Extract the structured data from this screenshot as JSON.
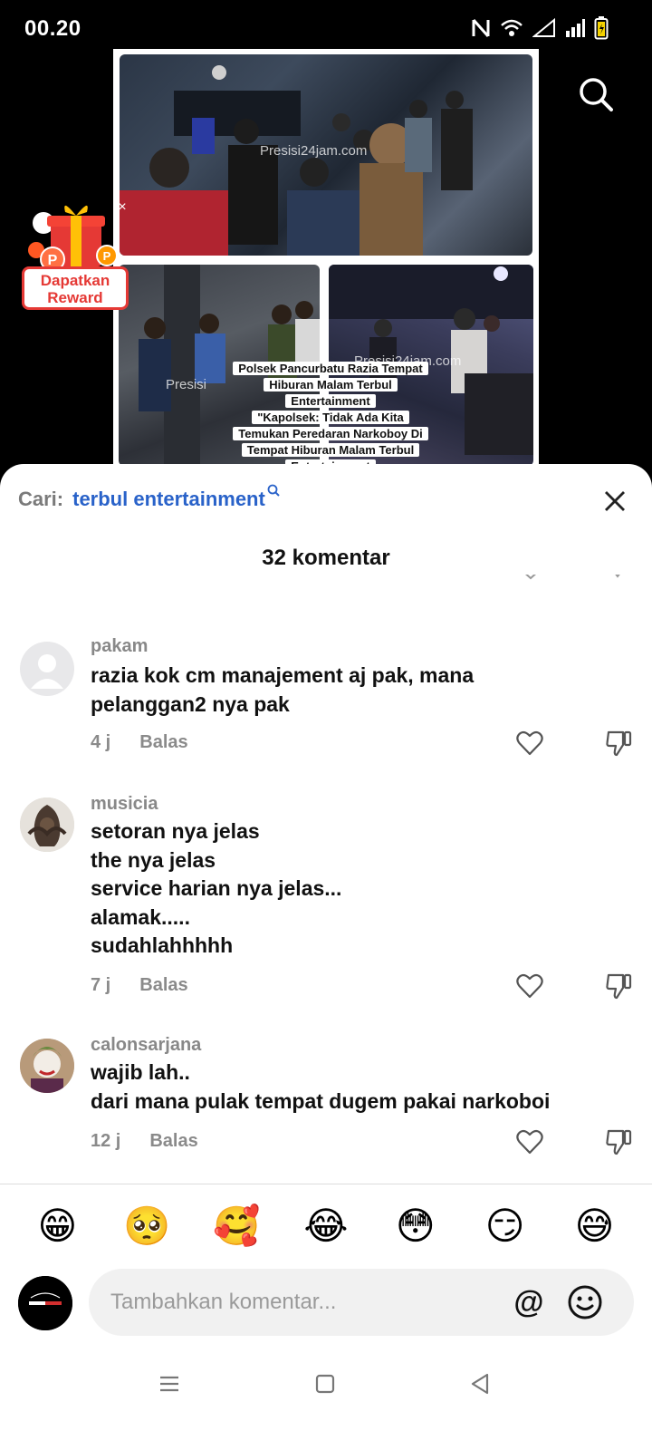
{
  "status_bar": {
    "time": "00.20"
  },
  "video": {
    "watermark_top": "Presisi24jam.com",
    "watermark_left": "Presisi",
    "watermark_right": "Presisi24jam.com",
    "caption_lines": [
      "Polsek Pancurbatu Razia Tempat",
      "Hiburan Malam Terbul",
      "Entertainment",
      "\"Kapolsek: Tidak Ada Kita",
      "Temukan Peredaran Narkoboy  Di",
      "Tempat Hiburan Malam Terbul",
      "Entertainment"
    ]
  },
  "reward": {
    "label_line1": "Dapatkan",
    "label_line2": "Reward",
    "close": "×"
  },
  "sheet": {
    "search_prefix": "Cari:",
    "search_term": "terbul entertainment",
    "comment_count": "32 komentar"
  },
  "comments": [
    {
      "user": "pakam",
      "text": "razia kok cm manajement aj pak, mana\npelanggan2 nya pak",
      "time": "4 j",
      "reply": "Balas"
    },
    {
      "user": "musicia",
      "text": "setoran nya jelas\nthe nya jelas\nservice harian nya jelas...\nalamak.....\nsudahlahhhhh",
      "time": "7 j",
      "reply": "Balas"
    },
    {
      "user": "calonsarjana",
      "text": "wajib lah..\ndari mana pulak tempat dugem pakai narkoboi",
      "time": "12 j",
      "reply": "Balas"
    }
  ],
  "emoji_bar": [
    "😁",
    "🥺",
    "🥰",
    "😂",
    "😳",
    "😏",
    "😅"
  ],
  "composer": {
    "placeholder": "Tambahkan komentar...",
    "at": "@"
  },
  "icons": {
    "video_search": "search-icon",
    "close": "close-icon",
    "like": "heart-icon",
    "dislike": "thumbs-down-icon",
    "emoji_picker": "smiley-icon"
  }
}
